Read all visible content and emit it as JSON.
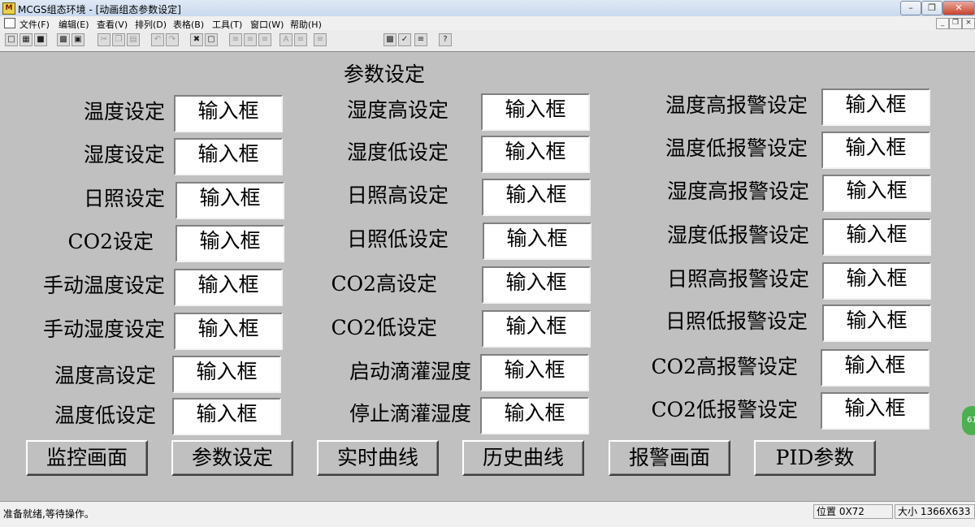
{
  "window": {
    "title": "MCGS组态环境 - [动画组态参数设定]",
    "app_icon": "mcgs-logo-icon"
  },
  "menu": {
    "items": [
      "文件(F)",
      "编辑(E)",
      "查看(V)",
      "排列(D)",
      "表格(B)",
      "工具(T)",
      "窗口(W)",
      "帮助(H)"
    ]
  },
  "toolbar": {
    "buttons": [
      "new-icon",
      "open-icon",
      "save-icon",
      "print-icon",
      "print-preview-icon",
      "cut-icon",
      "copy-icon",
      "paste-icon",
      "undo-icon",
      "redo-icon",
      "tools-icon",
      "frame-icon",
      "align-left-icon",
      "align-center-icon",
      "align-right-icon",
      "font-icon",
      "line-spacing-icon",
      "indent-icon",
      "properties-icon",
      "check-icon",
      "list-icon",
      "help-icon"
    ]
  },
  "page": {
    "title": "参数设定",
    "input_placeholder": "输入框",
    "col1": [
      "温度设定",
      "湿度设定",
      "日照设定",
      "CO2设定",
      "手动温度设定",
      "手动湿度设定",
      "温度高设定",
      "温度低设定"
    ],
    "col2": [
      "湿度高设定",
      "湿度低设定",
      "日照高设定",
      "日照低设定",
      "CO2高设定",
      "CO2低设定",
      "启动滴灌湿度",
      "停止滴灌湿度"
    ],
    "col3": [
      "温度高报警设定",
      "温度低报警设定",
      "湿度高报警设定",
      "湿度低报警设定",
      "日照高报警设定",
      "日照低报警设定",
      "CO2高报警设定",
      "CO2低报警设定"
    ],
    "nav": [
      "监控画面",
      "参数设定",
      "实时曲线",
      "历史曲线",
      "报警画面",
      "PID参数"
    ]
  },
  "status": {
    "message": "准备就绪,等待操作。",
    "position": "位置 0X72",
    "size": "大小 1366X633"
  },
  "side_badge": "61"
}
